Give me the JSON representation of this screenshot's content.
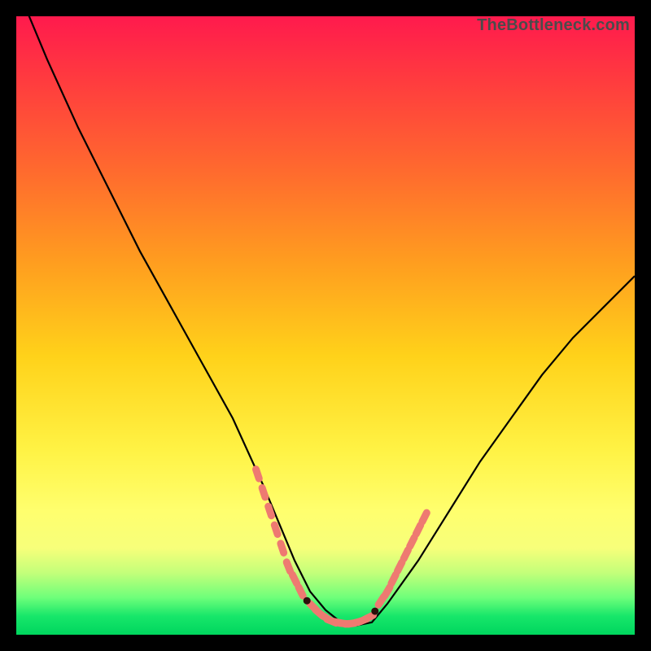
{
  "watermark": "TheBottleneck.com",
  "colors": {
    "background": "#000000",
    "curve": "#000000",
    "markers": "#ee7a71",
    "markers_dark": "#2b0f0b"
  },
  "chart_data": {
    "type": "line",
    "title": "",
    "xlabel": "",
    "ylabel": "",
    "xlim": [
      0,
      100
    ],
    "ylim": [
      0,
      100
    ],
    "series": [
      {
        "name": "curve",
        "x": [
          0,
          5,
          10,
          15,
          20,
          25,
          30,
          35,
          40,
          42.5,
          45,
          47.5,
          50,
          52.5,
          55,
          57.5,
          60,
          65,
          70,
          75,
          80,
          85,
          90,
          95,
          100
        ],
        "y": [
          105,
          93,
          82,
          72,
          62,
          53,
          44,
          35,
          24,
          18,
          12,
          7,
          4,
          2,
          1.5,
          2,
          5,
          12,
          20,
          28,
          35,
          42,
          48,
          53,
          58
        ]
      }
    ],
    "markers": {
      "pink_segments": [
        {
          "x": [
            39,
            40,
            41,
            42,
            43,
            44,
            45,
            46
          ],
          "y": [
            26,
            23,
            20,
            17,
            14,
            11,
            9,
            7
          ]
        },
        {
          "x": [
            48,
            49,
            50,
            51,
            52,
            53,
            54,
            55,
            56,
            57
          ],
          "y": [
            4.5,
            3.5,
            2.8,
            2.2,
            2,
            1.8,
            1.8,
            2,
            2.3,
            2.8
          ]
        },
        {
          "x": [
            59,
            60,
            61,
            62,
            63,
            64,
            65,
            66
          ],
          "y": [
            5.5,
            7,
            9,
            11,
            13,
            15,
            17,
            19
          ]
        }
      ],
      "dark_points": [
        {
          "x": 47,
          "y": 5.5
        },
        {
          "x": 58,
          "y": 3.8
        }
      ]
    }
  }
}
